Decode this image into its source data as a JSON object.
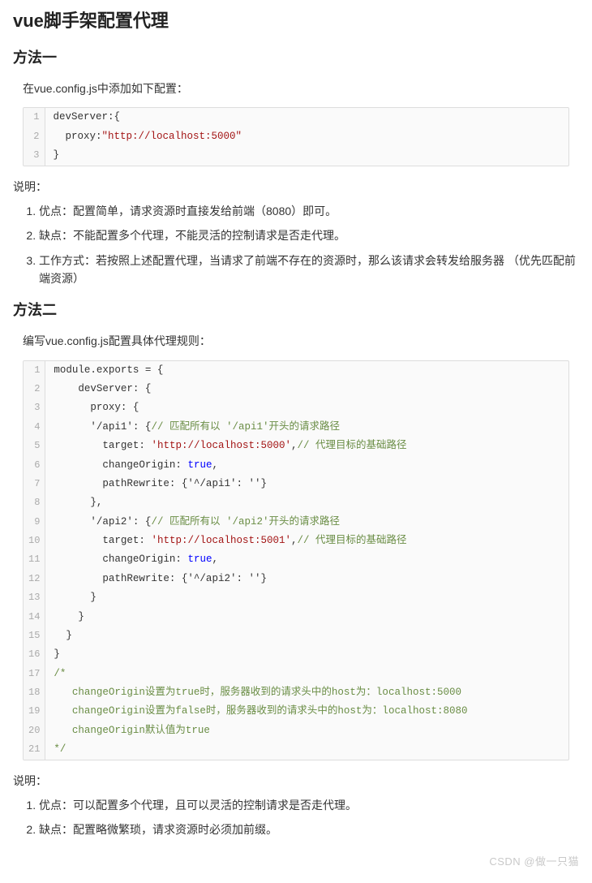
{
  "title": "vue脚手架配置代理",
  "method1": {
    "heading": "方法一",
    "intro": "在vue.config.js中添加如下配置：",
    "code": [
      [
        {
          "t": "devServer:{",
          "c": ""
        }
      ],
      [
        {
          "t": "  proxy:",
          "c": ""
        },
        {
          "t": "\"http://localhost:5000\"",
          "c": "tok-str"
        }
      ],
      [
        {
          "t": "}",
          "c": ""
        }
      ]
    ],
    "notesLabel": "说明：",
    "notes": [
      "优点：配置简单，请求资源时直接发给前端（8080）即可。",
      "缺点：不能配置多个代理，不能灵活的控制请求是否走代理。",
      "工作方式：若按照上述配置代理，当请求了前端不存在的资源时，那么该请求会转发给服务器 （优先匹配前端资源）"
    ]
  },
  "method2": {
    "heading": "方法二",
    "intro": "编写vue.config.js配置具体代理规则：",
    "code": [
      [
        {
          "t": "module.exports = {",
          "c": ""
        }
      ],
      [
        {
          "t": "    devServer: {",
          "c": ""
        }
      ],
      [
        {
          "t": "      proxy: {",
          "c": ""
        }
      ],
      [
        {
          "t": "      '/api1': {",
          "c": ""
        },
        {
          "t": "// 匹配所有以 '/api1'开头的请求路径",
          "c": "tok-cmt"
        }
      ],
      [
        {
          "t": "        target: ",
          "c": ""
        },
        {
          "t": "'http://localhost:5000'",
          "c": "tok-str"
        },
        {
          "t": ",",
          "c": ""
        },
        {
          "t": "// 代理目标的基础路径",
          "c": "tok-cmt"
        }
      ],
      [
        {
          "t": "        changeOrigin: ",
          "c": ""
        },
        {
          "t": "true",
          "c": "tok-true"
        },
        {
          "t": ",",
          "c": ""
        }
      ],
      [
        {
          "t": "        pathRewrite: {'^/api1': ''}",
          "c": ""
        }
      ],
      [
        {
          "t": "      },",
          "c": ""
        }
      ],
      [
        {
          "t": "      '/api2': {",
          "c": ""
        },
        {
          "t": "// 匹配所有以 '/api2'开头的请求路径",
          "c": "tok-cmt"
        }
      ],
      [
        {
          "t": "        target: ",
          "c": ""
        },
        {
          "t": "'http://localhost:5001'",
          "c": "tok-str"
        },
        {
          "t": ",",
          "c": ""
        },
        {
          "t": "// 代理目标的基础路径",
          "c": "tok-cmt"
        }
      ],
      [
        {
          "t": "        changeOrigin: ",
          "c": ""
        },
        {
          "t": "true",
          "c": "tok-true"
        },
        {
          "t": ",",
          "c": ""
        }
      ],
      [
        {
          "t": "        pathRewrite: {'^/api2': ''}",
          "c": ""
        }
      ],
      [
        {
          "t": "      }",
          "c": ""
        }
      ],
      [
        {
          "t": "    }",
          "c": ""
        }
      ],
      [
        {
          "t": "  }",
          "c": ""
        }
      ],
      [
        {
          "t": "}",
          "c": ""
        }
      ],
      [
        {
          "t": "/*",
          "c": "tok-cmt"
        }
      ],
      [
        {
          "t": "   changeOrigin设置为true时，服务器收到的请求头中的host为：localhost:5000",
          "c": "tok-cmt"
        }
      ],
      [
        {
          "t": "   changeOrigin设置为false时，服务器收到的请求头中的host为：localhost:8080",
          "c": "tok-cmt"
        }
      ],
      [
        {
          "t": "   changeOrigin默认值为true",
          "c": "tok-cmt"
        }
      ],
      [
        {
          "t": "*/",
          "c": "tok-cmt"
        }
      ]
    ],
    "notesLabel": "说明：",
    "notes": [
      "优点：可以配置多个代理，且可以灵活的控制请求是否走代理。",
      "缺点：配置略微繁琐，请求资源时必须加前缀。"
    ]
  },
  "watermark": "CSDN @做一只猫"
}
